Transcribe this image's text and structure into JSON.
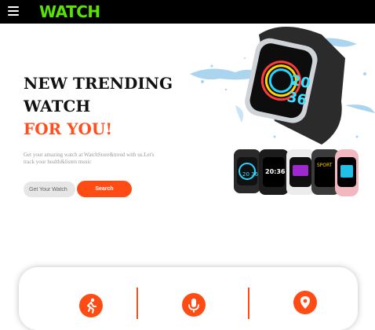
{
  "header": {
    "logo_text": "WATCH",
    "menu_icon": "hamburger-menu-icon",
    "logo_color": "#58e400"
  },
  "hero": {
    "title_line1": "NEW TRENDING",
    "title_line2": "WATCH",
    "title_accent": "FOR YOU!",
    "accent_color": "#ff4f1f",
    "description": "Get your amazing watch at WatchStore&trend with us.Let's track your health&listen music",
    "watch_faces": [
      "20",
      "36"
    ],
    "small_watch_faces": [
      "20 36",
      "20:36",
      "SPORT"
    ]
  },
  "search": {
    "placeholder": "Get Your Watch",
    "button_label": "Search"
  },
  "features": {
    "icons": [
      "running-icon",
      "microphone-icon",
      "location-pin-icon"
    ]
  }
}
